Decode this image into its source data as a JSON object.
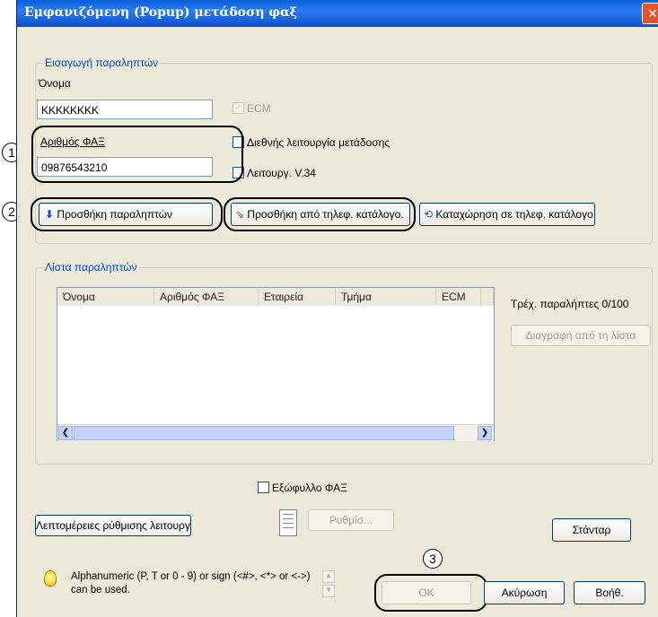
{
  "window": {
    "title": "Εμφανιζόμενη (Popup) μετάδοση φαξ",
    "close_symbol": "✕"
  },
  "recipient_input": {
    "group_label": "Εισαγωγή παραληπτών",
    "name_label": "Όνομα",
    "name_value": "KKKKKKKK",
    "ecm_label": "ECM",
    "fax_label": "Αριθμός ΦΑΞ",
    "fax_value": "09876543210",
    "intl_label": "Διεθνής λειτουργία μετάδοσης",
    "v34_label": "Λειτουργ. V.34",
    "add_recipient_label": "Προσθήκη παραληπτών",
    "add_from_phonebook_label": "Προσθήκη από τηλεφ. κατάλογο.",
    "register_phonebook_label": "Καταχώρηση σε τηλεφ. κατάλογο"
  },
  "recipient_list": {
    "group_label": "Λίστα παραληπτών",
    "columns": [
      "Όνομα",
      "Αριθμός ΦΑΞ",
      "Εταιρεία",
      "Τμήμα",
      "ECM"
    ],
    "current_count": "Τρέχ. παραλήπτες 0/100",
    "delete_label": "Διαγραφή από τη λίστα"
  },
  "cover_label": "Εξώφυλλο ΦΑΞ",
  "details_label": "Λεπτομέρειες ρύθμισης λειτουργίας",
  "settings_label": "Ρυθμίσ...",
  "default_label": "Στάνταρ",
  "hint_text": "Alphanumeric (P, T or 0 - 9) or sign (<#>, <*> or <->) can be used.",
  "ok_label": "OK",
  "cancel_label": "Ακύρωση",
  "help_label": "Βοήθ.",
  "callouts": [
    "1",
    "2",
    "3"
  ]
}
